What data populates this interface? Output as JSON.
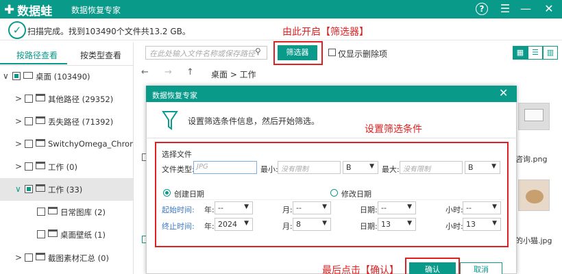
{
  "app": {
    "name": "数据蛙",
    "title": "数据恢复专家",
    "colors": {
      "brand": "#0a9a8a",
      "annotation": "#e02020"
    }
  },
  "window_controls": {
    "help": "?",
    "menu": "☰",
    "minimize": "—",
    "close": "✕"
  },
  "status": {
    "text": "扫描完成。找到103490个文件共13.2 GB。"
  },
  "left_panel": {
    "tabs": [
      "按路径查看",
      "按类型查看"
    ],
    "tree": [
      {
        "label": "桌面 (103490)"
      },
      {
        "label": "其他路径 (29352)"
      },
      {
        "label": "丢失路径 (71392)"
      },
      {
        "label": "SwitchyOmega_Chromium"
      },
      {
        "label": "工作 (0)"
      },
      {
        "label": "工作 (33)"
      },
      {
        "label": "日常图库 (2)"
      },
      {
        "label": "桌面壁纸 (1)"
      },
      {
        "label": "截图素材汇总 (0)"
      }
    ]
  },
  "toolbar": {
    "search_placeholder": "在此处输入文件名称或保存路径",
    "filter_label": "筛选器",
    "show_deleted_label": "仅显示删除项"
  },
  "nav": {
    "back": "←",
    "forward": "→",
    "up": "↑",
    "breadcrumb": "桌面 > 工作"
  },
  "background_files": [
    "咨询.png",
    "的小猫.jpg"
  ],
  "annotations": {
    "filter": "由此开启【筛选器】",
    "conditions": "设置筛选条件",
    "confirm": "最后点击【确认】"
  },
  "dialog": {
    "title": "数据恢复专家",
    "description": "设置筛选条件信息，然后开始筛选。",
    "section_title": "选择文件",
    "file_type_label": "文件类型:",
    "file_type_placeholder": "JPG",
    "min_label": "最小:",
    "min_placeholder": "没有限制",
    "min_unit": "B",
    "max_label": "最大:",
    "max_placeholder": "没有限制",
    "max_unit": "B",
    "create_date_label": "创建日期",
    "modify_date_label": "修改日期",
    "start_label": "起始时间:",
    "end_label": "终止时间:",
    "year_label": "年:",
    "month_label": "月:",
    "day_label": "日期:",
    "hour_label": "小时:",
    "start": {
      "year": "--",
      "month": "--",
      "day": "--",
      "hour": "--"
    },
    "end": {
      "year": "2024",
      "month": "8",
      "day": "13",
      "hour": "13"
    },
    "ok_label": "确认",
    "cancel_label": "取消"
  }
}
